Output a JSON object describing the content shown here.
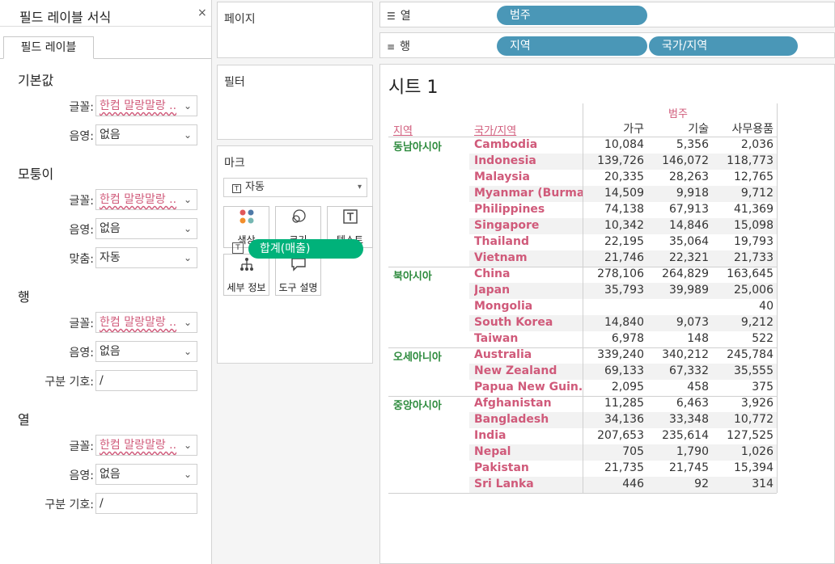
{
  "format_panel": {
    "title": "필드 레이블 서식",
    "close_glyph": "×",
    "tab_label": "필드 레이블",
    "sections": {
      "default": {
        "title": "기본값",
        "font_label": "글꼴:",
        "font_value": "한컴 말랑말랑 ..",
        "shade_label": "음영:",
        "shade_value": "없음"
      },
      "corner": {
        "title": "모퉁이",
        "font_label": "글꼴:",
        "font_value": "한컴 말랑말랑 ..",
        "shade_label": "음영:",
        "shade_value": "없음",
        "align_label": "맞춤:",
        "align_value": "자동"
      },
      "row": {
        "title": "행",
        "font_label": "글꼴:",
        "font_value": "한컴 말랑말랑 ..",
        "shade_label": "음영:",
        "shade_value": "없음",
        "sep_label": "구분 기호:",
        "sep_value": "/"
      },
      "col": {
        "title": "열",
        "font_label": "글꼴:",
        "font_value": "한컴 말랑말랑 ..",
        "shade_label": "음영:",
        "shade_value": "없음",
        "sep_label": "구분 기호:",
        "sep_value": "/"
      }
    }
  },
  "pages_card": {
    "title": "페이지"
  },
  "filters_card": {
    "title": "필터"
  },
  "marks_card": {
    "title": "마크",
    "type_value": "자동",
    "type_icon": "text-mark-icon",
    "buttons": [
      {
        "label": "색상",
        "icon": "color-dots-icon"
      },
      {
        "label": "크기",
        "icon": "size-circles-icon"
      },
      {
        "label": "텍스트",
        "icon": "text-box-icon"
      },
      {
        "label": "세부 정보",
        "icon": "detail-tree-icon"
      },
      {
        "label": "도구 설명",
        "icon": "tooltip-bubble-icon"
      }
    ],
    "text_pill": "합계(매출)"
  },
  "columns_shelf": {
    "label": "열",
    "icon": "columns-icon",
    "pills": [
      "범주"
    ]
  },
  "rows_shelf": {
    "label": "행",
    "icon": "rows-icon",
    "pills": [
      "지역",
      "국가/지역"
    ]
  },
  "sheet": {
    "title": "시트 1",
    "col_field_header": "범주",
    "row_field_headers": [
      "지역",
      "국가/지역"
    ],
    "categories": [
      "가구",
      "기술",
      "사무용품"
    ],
    "colors": {
      "field_label": "#d05a7a",
      "region": "#2e8b3e",
      "pill": "#4a97b7",
      "measure_pill": "#00b27a"
    },
    "regions": [
      {
        "name": "동남아시아",
        "rows": [
          {
            "country": "Cambodia",
            "values": [
              "10,084",
              "5,356",
              "2,036"
            ]
          },
          {
            "country": "Indonesia",
            "values": [
              "139,726",
              "146,072",
              "118,773"
            ]
          },
          {
            "country": "Malaysia",
            "values": [
              "20,335",
              "28,263",
              "12,765"
            ]
          },
          {
            "country": "Myanmar (Burma)",
            "values": [
              "14,509",
              "9,918",
              "9,712"
            ]
          },
          {
            "country": "Philippines",
            "values": [
              "74,138",
              "67,913",
              "41,369"
            ]
          },
          {
            "country": "Singapore",
            "values": [
              "10,342",
              "14,846",
              "15,098"
            ]
          },
          {
            "country": "Thailand",
            "values": [
              "22,195",
              "35,064",
              "19,793"
            ]
          },
          {
            "country": "Vietnam",
            "values": [
              "21,746",
              "22,321",
              "21,733"
            ]
          }
        ]
      },
      {
        "name": "북아시아",
        "rows": [
          {
            "country": "China",
            "values": [
              "278,106",
              "264,829",
              "163,645"
            ]
          },
          {
            "country": "Japan",
            "values": [
              "35,793",
              "39,989",
              "25,006"
            ]
          },
          {
            "country": "Mongolia",
            "values": [
              "",
              "",
              "40"
            ]
          },
          {
            "country": "South Korea",
            "values": [
              "14,840",
              "9,073",
              "9,212"
            ]
          },
          {
            "country": "Taiwan",
            "values": [
              "6,978",
              "148",
              "522"
            ]
          }
        ]
      },
      {
        "name": "오세아니아",
        "rows": [
          {
            "country": "Australia",
            "values": [
              "339,240",
              "340,212",
              "245,784"
            ]
          },
          {
            "country": "New Zealand",
            "values": [
              "69,133",
              "67,332",
              "35,555"
            ]
          },
          {
            "country": "Papua New Guin..",
            "values": [
              "2,095",
              "458",
              "375"
            ]
          }
        ]
      },
      {
        "name": "중앙아시아",
        "rows": [
          {
            "country": "Afghanistan",
            "values": [
              "11,285",
              "6,463",
              "3,926"
            ]
          },
          {
            "country": "Bangladesh",
            "values": [
              "34,136",
              "33,348",
              "10,772"
            ]
          },
          {
            "country": "India",
            "values": [
              "207,653",
              "235,614",
              "127,525"
            ]
          },
          {
            "country": "Nepal",
            "values": [
              "705",
              "1,790",
              "1,026"
            ]
          },
          {
            "country": "Pakistan",
            "values": [
              "21,735",
              "21,745",
              "15,394"
            ]
          },
          {
            "country": "Sri Lanka",
            "values": [
              "446",
              "92",
              "314"
            ]
          }
        ]
      }
    ]
  }
}
